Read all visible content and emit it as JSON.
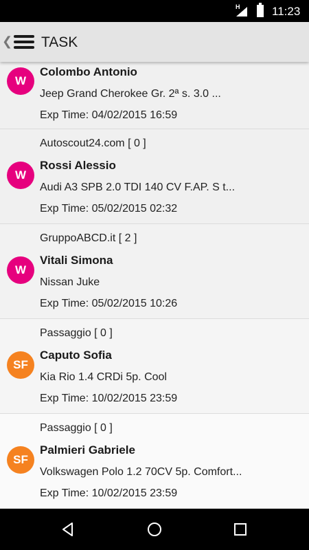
{
  "status_bar": {
    "network": "H",
    "time": "11:23"
  },
  "app_bar": {
    "title": "TASK"
  },
  "tasks": [
    {
      "source": "",
      "name": "Colombo Antonio",
      "vehicle": "Jeep Grand Cherokee Gr.  2ª s.  3.0 ...",
      "exp": "Exp Time: 04/02/2015 16:59",
      "avatar_text": "W",
      "avatar_color": "#e6007e"
    },
    {
      "source": "Autoscout24.com [ 0 ]",
      "name": "Rossi Alessio",
      "vehicle": "Audi A3 SPB 2.0 TDI 140 CV F.AP. S t...",
      "exp": "Exp Time: 05/02/2015 02:32",
      "avatar_text": "W",
      "avatar_color": "#e6007e"
    },
    {
      "source": "GruppoABCD.it [ 2 ]",
      "name": "Vitali Simona",
      "vehicle": "Nissan Juke",
      "exp": "Exp Time: 05/02/2015 10:26",
      "avatar_text": "W",
      "avatar_color": "#e6007e"
    },
    {
      "source": "Passaggio [ 0 ]",
      "name": "Caputo Sofia",
      "vehicle": "Kia Rio 1.4 CRDi 5p. Cool",
      "exp": "Exp Time: 10/02/2015 23:59",
      "avatar_text": "SF",
      "avatar_color": "#f58220"
    },
    {
      "source": "Passaggio [ 0 ]",
      "name": "Palmieri Gabriele",
      "vehicle": "Volkswagen Polo 1.2 70CV 5p. Comfort...",
      "exp": "Exp Time: 10/02/2015 23:59",
      "avatar_text": "SF",
      "avatar_color": "#f58220"
    }
  ]
}
